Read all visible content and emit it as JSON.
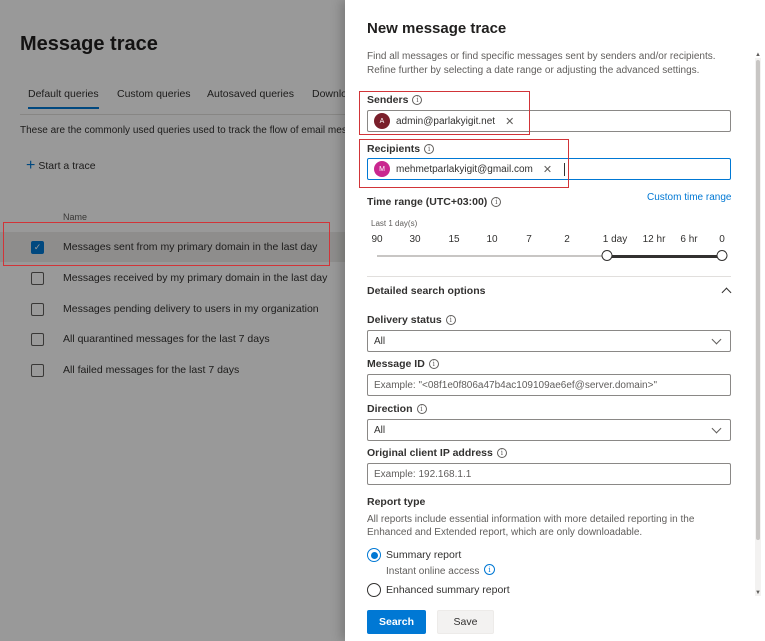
{
  "background": {
    "title": "Message trace",
    "tabs": [
      "Default queries",
      "Custom queries",
      "Autosaved queries",
      "Downlo"
    ],
    "description": "These are the commonly used queries used to track the flow of email mes",
    "start_trace_label": "Start a trace",
    "column_header": "Name",
    "queries": [
      {
        "label": "Messages sent from my primary domain in the last day",
        "checked": true
      },
      {
        "label": "Messages received by my primary domain in the last day",
        "checked": false
      },
      {
        "label": "Messages pending delivery to users in my organization",
        "checked": false
      },
      {
        "label": "All quarantined messages for the last 7 days",
        "checked": false
      },
      {
        "label": "All failed messages for the last 7 days",
        "checked": false
      }
    ]
  },
  "panel": {
    "title": "New message trace",
    "description": "Find all messages or find specific messages sent by senders and/or recipients. Refine further by selecting a date range or adjusting the advanced settings.",
    "senders": {
      "label": "Senders",
      "chip": {
        "initial": "A",
        "value": "admin@parlakyigit.net",
        "color": "#7a1f2b"
      }
    },
    "recipients": {
      "label": "Recipients",
      "chip": {
        "initial": "M",
        "value": "mehmetparlakyigit@gmail.com",
        "color": "#c9278f"
      }
    },
    "time_range": {
      "label": "Time range (UTC+03:00)",
      "custom_link": "Custom time range",
      "selected_text": "Last 1 day(s)",
      "ticks": [
        "90",
        "30",
        "15",
        "10",
        "7",
        "2",
        "1 day",
        "12 hr",
        "6 hr",
        "0"
      ],
      "selected_from": "1 day",
      "selected_to": "0"
    },
    "detailed": {
      "heading": "Detailed search options",
      "delivery_status": {
        "label": "Delivery status",
        "value": "All"
      },
      "message_id": {
        "label": "Message ID",
        "placeholder": "Example: \"<08f1e0f806a47b4ac109109ae6ef@server.domain>\""
      },
      "direction": {
        "label": "Direction",
        "value": "All"
      },
      "client_ip": {
        "label": "Original client IP address",
        "placeholder": "Example: 192.168.1.1"
      }
    },
    "report_type": {
      "label": "Report type",
      "description": "All reports include essential information with more detailed reporting in the Enhanced and Extended report, which are only downloadable.",
      "options": [
        {
          "label": "Summary report",
          "sub": "Instant online access",
          "selected": true
        },
        {
          "label": "Enhanced summary report",
          "selected": false
        }
      ]
    },
    "buttons": {
      "search": "Search",
      "save": "Save"
    }
  },
  "colors": {
    "accent": "#0078d4",
    "highlight": "#d13438"
  }
}
